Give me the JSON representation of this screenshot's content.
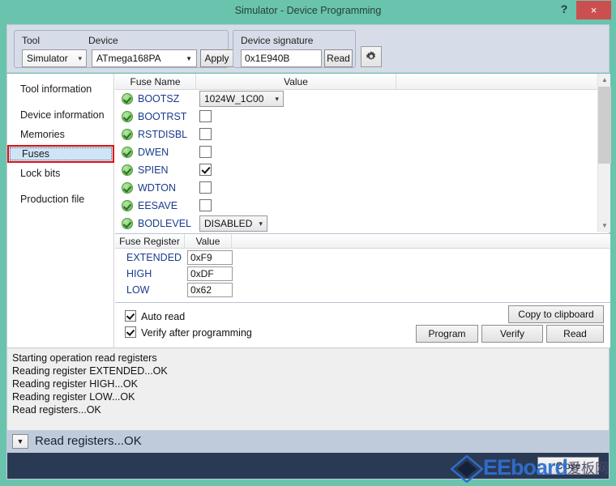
{
  "window": {
    "title": "Simulator - Device Programming",
    "help_label": "?",
    "close_label": "×",
    "accent_color": "#6ac3ad",
    "close_button_color": "#cc4f4f"
  },
  "toolbar": {
    "tool_group_label": "Tool",
    "device_group_label": "Device",
    "tool_value": "Simulator",
    "device_value": "ATmega168PA",
    "apply_label": "Apply",
    "signature_group_label": "Device signature",
    "signature_value": "0x1E940B",
    "read_label": "Read",
    "gear_icon": "gear-icon"
  },
  "sidebar": {
    "items": [
      {
        "label": "Tool information",
        "selected": false
      },
      {
        "label": "Device information",
        "selected": false
      },
      {
        "label": "Memories",
        "selected": false
      },
      {
        "label": "Fuses",
        "selected": true
      },
      {
        "label": "Lock bits",
        "selected": false
      },
      {
        "label": "Production file",
        "selected": false
      }
    ]
  },
  "fuse_table": {
    "columns": [
      "Fuse Name",
      "Value"
    ],
    "rows": [
      {
        "name": "BOOTSZ",
        "type": "combo",
        "value": "1024W_1C00",
        "checked": false
      },
      {
        "name": "BOOTRST",
        "type": "checkbox",
        "value": "",
        "checked": false
      },
      {
        "name": "RSTDISBL",
        "type": "checkbox",
        "value": "",
        "checked": false
      },
      {
        "name": "DWEN",
        "type": "checkbox",
        "value": "",
        "checked": false
      },
      {
        "name": "SPIEN",
        "type": "checkbox",
        "value": "",
        "checked": true
      },
      {
        "name": "WDTON",
        "type": "checkbox",
        "value": "",
        "checked": false
      },
      {
        "name": "EESAVE",
        "type": "checkbox",
        "value": "",
        "checked": false
      },
      {
        "name": "BODLEVEL",
        "type": "combo",
        "value": "DISABLED",
        "checked": false
      }
    ],
    "scrollbar": {
      "up_icon": "chevron-up-icon",
      "down_icon": "chevron-down-icon"
    }
  },
  "register_table": {
    "columns": [
      "Fuse Register",
      "Value"
    ],
    "rows": [
      {
        "name": "EXTENDED",
        "value": "0xF9"
      },
      {
        "name": "HIGH",
        "value": "0xDF"
      },
      {
        "name": "LOW",
        "value": "0x62"
      }
    ]
  },
  "options": {
    "auto_read": {
      "label": "Auto read",
      "checked": true
    },
    "verify_after_programming": {
      "label": "Verify after programming",
      "checked": true
    },
    "copy_to_clipboard_label": "Copy to clipboard",
    "program_label": "Program",
    "verify_label": "Verify",
    "read_label": "Read"
  },
  "log": {
    "lines": [
      "Starting operation read registers",
      "Reading register EXTENDED...OK",
      "Reading register HIGH...OK",
      "Reading register LOW...OK",
      "Read registers...OK"
    ]
  },
  "status": {
    "toggle_icon": "chevron-down-icon",
    "text": "Read registers...OK"
  },
  "footer": {
    "close_label": "Close"
  },
  "watermark": {
    "text": "EEboard",
    "text_cn": "爱板网",
    "logo_icon": "diamond-logo-icon"
  }
}
